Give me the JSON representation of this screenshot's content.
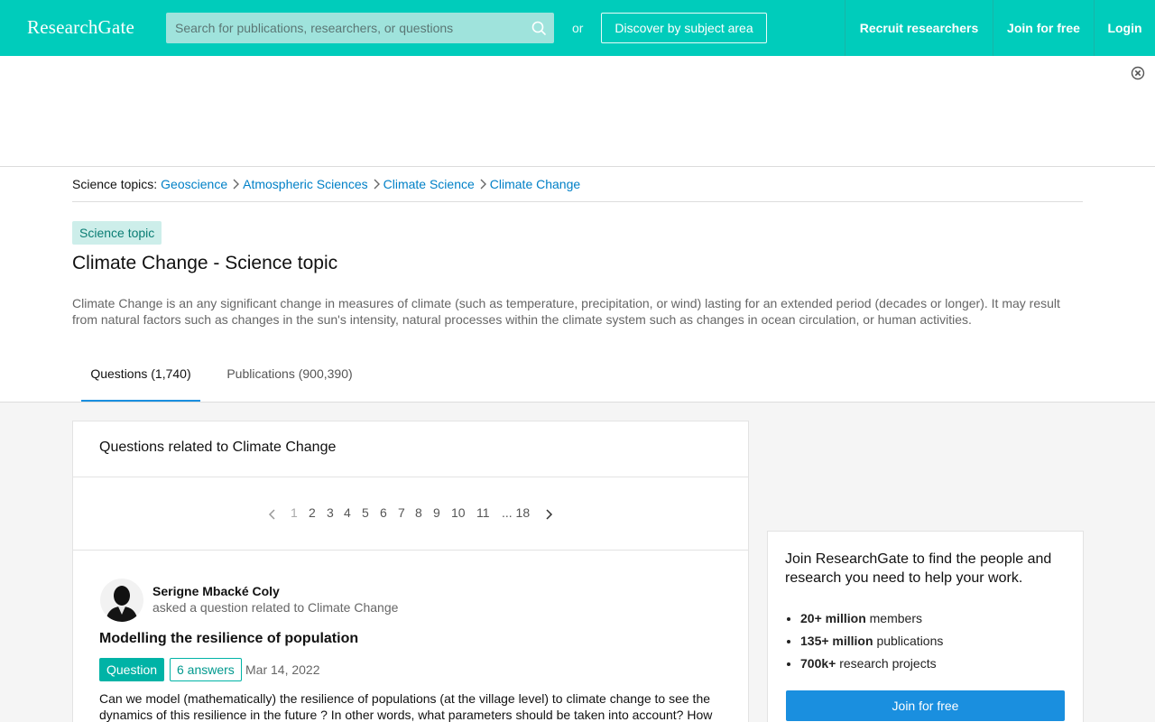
{
  "header": {
    "logo": "ResearchGate",
    "search_placeholder": "Search for publications, researchers, or questions",
    "or_text": "or",
    "discover_label": "Discover by subject area",
    "recruit_label": "Recruit researchers",
    "join_label": "Join for free",
    "login_label": "Login"
  },
  "breadcrumb": {
    "label": "Science topics:",
    "items": [
      "Geoscience",
      "Atmospheric Sciences",
      "Climate Science",
      "Climate Change"
    ]
  },
  "topic": {
    "badge": "Science topic",
    "title": "Climate Change - Science topic",
    "description": "Climate Change is an any significant change in measures of climate (such as temperature, precipitation, or wind) lasting for an extended period (decades or longer). It may result from natural factors such as changes in the sun's intensity, natural processes within the climate system such as changes in ocean circulation, or human activities."
  },
  "tabs": [
    {
      "label": "Questions (1,740)",
      "active": true
    },
    {
      "label": "Publications (900,390)",
      "active": false
    }
  ],
  "questions_card": {
    "heading": "Questions related to Climate Change",
    "pagination": [
      "1",
      "2",
      "3",
      "4",
      "5",
      "6",
      "7",
      "8",
      "9",
      "10",
      "11",
      "... 18"
    ],
    "current_page": "1",
    "question": {
      "author": "Serigne Mbacké Coly",
      "asked_text": "asked a question related to Climate Change",
      "title": "Modelling the resilience of population",
      "type_badge": "Question",
      "answers_badge": "6 answers",
      "date": "Mar 14, 2022",
      "body": "Can we model (mathematically) the resilience of populations (at the village level) to climate change to see the dynamics of this resilience in the future ? In other words, what parameters should be taken into account? How"
    }
  },
  "join_panel": {
    "heading": "Join ResearchGate to find the people and research you need to help your work.",
    "stats": [
      {
        "value": "20+ million",
        "label": "members"
      },
      {
        "value": "135+ million",
        "label": "publications"
      },
      {
        "value": "700k+",
        "label": "research projects"
      }
    ],
    "button_label": "Join for free"
  },
  "colors": {
    "brand": "#00ccbb",
    "link": "#0080c7",
    "button_blue": "#1a8fdf"
  },
  "icons": [
    "search-icon",
    "close-circle-icon",
    "chevron-right-icon",
    "chevron-left-icon"
  ]
}
